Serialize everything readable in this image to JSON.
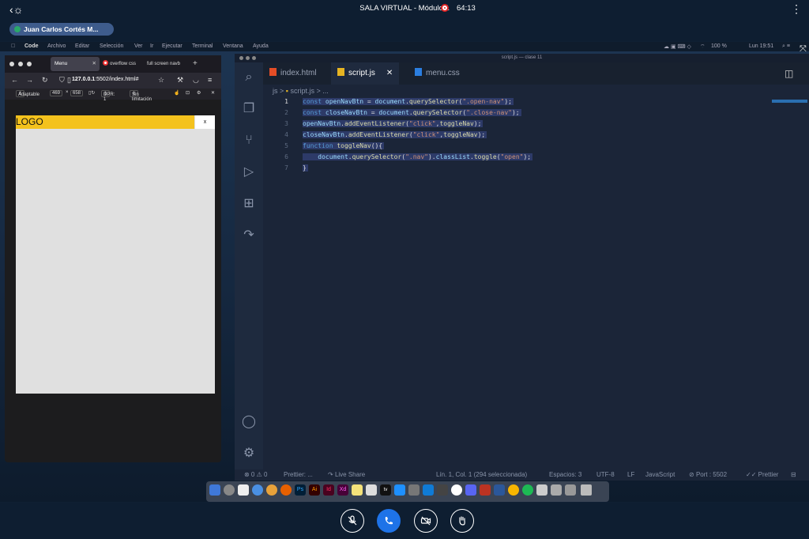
{
  "call": {
    "back_icon": "person-back-icon",
    "title": "SALA VIRTUAL - Módulo 1",
    "timer": "64:13",
    "presenter": "Juan Carlos Cortés M...",
    "more_icon": "⋮"
  },
  "macmenu": {
    "items": [
      "",
      "Code",
      "Archivo",
      "Editar",
      "Selección",
      "Ver",
      "Ir",
      "Ejecutar",
      "Terminal",
      "Ventana",
      "Ayuda"
    ],
    "battery": "100 %",
    "clock": "Lun 19:51"
  },
  "browser": {
    "tabs": [
      "Menu",
      "overflow css",
      "full screen navb"
    ],
    "url_host": "127.0.0.1",
    "url_path": ":5502/index.html#",
    "rd": {
      "mode": "Adaptable",
      "width": "469",
      "x": "×",
      "height": "658",
      "dpr": "DPR: 1",
      "throttle": "Sin limitación"
    },
    "page": {
      "logo": "LOGO",
      "close": "x"
    }
  },
  "editor": {
    "window_title": "script.js — clase 11",
    "tabs": [
      "index.html",
      "script.js",
      "menu.css"
    ],
    "breadcrumb_folder": "js",
    "breadcrumb_file": "script.js",
    "breadcrumb_more": "...",
    "line_numbers": [
      "1",
      "2",
      "3",
      "4",
      "5",
      "6",
      "7"
    ],
    "status": {
      "problems": "⊗ 0 ⚠ 0",
      "prettier_left": "Prettier: ...",
      "live_share": "Live Share",
      "cursor": "Lín. 1, Col. 1 (294 seleccionada)",
      "spaces": "Espacios: 3",
      "encoding": "UTF-8",
      "eol": "LF",
      "language": "JavaScript",
      "port": "Port : 5502",
      "prettier": "Prettier"
    }
  },
  "controls": {
    "mute_icon": "mic-off-icon",
    "call_icon": "phone-icon",
    "video_icon": "camera-off-icon",
    "hand_icon": "raise-hand-icon"
  }
}
